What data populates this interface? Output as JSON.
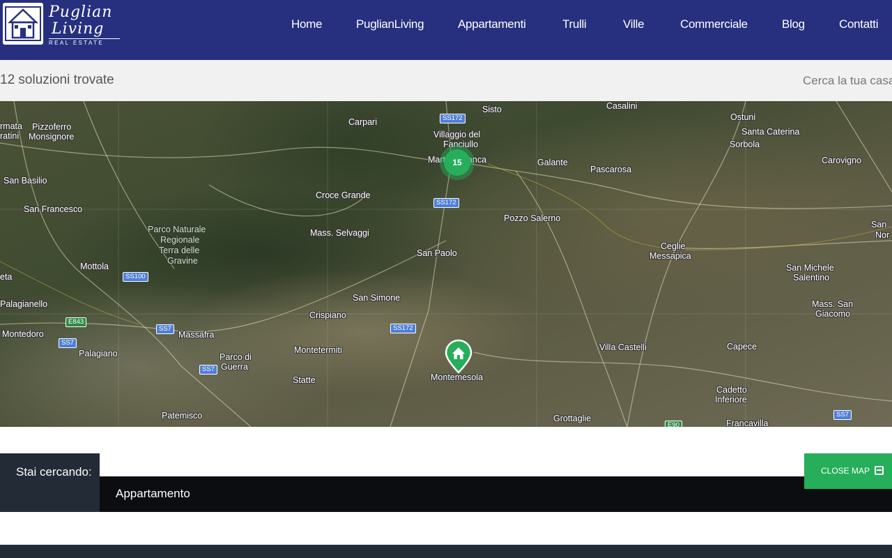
{
  "header": {
    "logo_name_line1": "Puglian",
    "logo_name_line2": "Living",
    "logo_sub": "REAL ESTATE",
    "nav": [
      "Home",
      "PuglianLiving",
      "Appartamenti",
      "Trulli",
      "Ville",
      "Commerciale",
      "Blog",
      "Contatti"
    ]
  },
  "results": {
    "count_text": "12 soluzioni trovate",
    "search_link": "Cerca la tua casa"
  },
  "map": {
    "places": [
      "Sisto",
      "Casalini",
      "Ostuni",
      "Santa Caterina",
      "Carpari",
      "Villaggio del",
      "Fanciullo",
      "Martina Franca",
      "Galante",
      "Pascarosa",
      "Sorbola",
      "Carovigno",
      "rmata",
      "ratini",
      "Pizzoferro",
      "Monsignore",
      "San Basilio",
      "Croce Grande",
      "San Francesco",
      "Pozzo Salerno",
      "Parco Naturale",
      "Regionale",
      "Terra delle",
      "Gravine",
      "Mass. Selvaggi",
      "Ceglie",
      "Messapica",
      "San Paolo",
      "Mottola",
      "San Michele",
      "Salentino",
      "eta",
      "San Simone",
      "Mass. San",
      "Giacomo",
      "Palagianello",
      "Crispiano",
      "Montedoro",
      "Massafra",
      "Palagiano",
      "Montetermiti",
      "Villa Castelli",
      "Capece",
      "Parco di",
      "Guerra",
      "Statte",
      "Montemesola",
      "Cadetto",
      "Inferiore",
      "Patemisco",
      "Grottaglie",
      "Francavilla",
      "San",
      "Nor"
    ],
    "roads": [
      "SS172",
      "SS172",
      "SS172",
      "SS100",
      "E843",
      "SS7",
      "SS7",
      "SS7",
      "E90",
      "SS7"
    ],
    "cluster_count": "15"
  },
  "filters": {
    "label": "Stai cercando:",
    "value": "Appartamento"
  },
  "close_map_label": "CLOSE MAP",
  "colors": {
    "header": "#26307f",
    "accent_green": "#26ae5a",
    "dark": "#232b36"
  }
}
